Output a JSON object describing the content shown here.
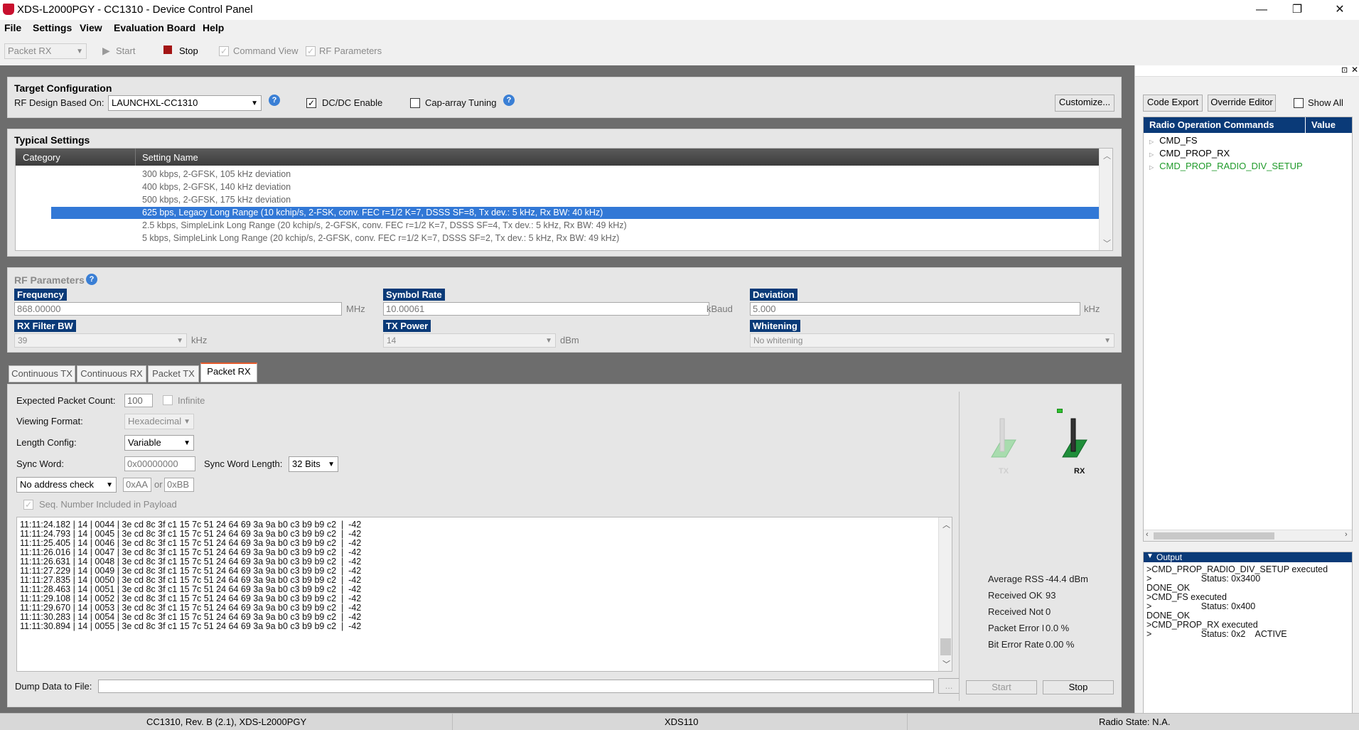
{
  "window": {
    "title": "XDS-L2000PGY - CC1310 - Device Control Panel",
    "minimize": "—",
    "restore": "❐",
    "close": "✕"
  },
  "menu": [
    "File",
    "Settings",
    "View",
    "Evaluation Board",
    "Help"
  ],
  "toolbar": {
    "mode": "Packet RX",
    "start": "Start",
    "stop": "Stop",
    "command_view": "Command View",
    "rf_parameters": "RF Parameters"
  },
  "target_config": {
    "title": "Target Configuration",
    "rf_design_label": "RF Design Based On:",
    "rf_design_value": "LAUNCHXL-CC1310",
    "dcdc": "DC/DC Enable",
    "dcdc_checked": true,
    "cap_array": "Cap-array Tuning",
    "cap_array_checked": false,
    "customize": "Customize..."
  },
  "typical_settings": {
    "title": "Typical Settings",
    "col_category": "Category",
    "col_setting": "Setting Name",
    "rows": [
      "300 kbps, 2-GFSK, 105 kHz deviation",
      "400 kbps, 2-GFSK, 140 kHz deviation",
      "500 kbps, 2-GFSK, 175 kHz deviation",
      "625 bps, Legacy Long Range (10 kchip/s, 2-FSK, conv. FEC r=1/2 K=7, DSSS SF=8, Tx dev.: 5 kHz, Rx BW: 40 kHz)",
      "2.5 kbps, SimpleLink Long Range (20 kchip/s, 2-GFSK, conv. FEC r=1/2 K=7, DSSS SF=4, Tx dev.: 5 kHz, Rx BW: 49 kHz)",
      "5 kbps, SimpleLink Long Range (20 kchip/s, 2-GFSK, conv. FEC r=1/2 K=7, DSSS SF=2, Tx dev.: 5 kHz, Rx BW: 49 kHz)"
    ],
    "selected_index": 3
  },
  "rf_params": {
    "title": "RF Parameters",
    "frequency_label": "Frequency",
    "frequency": "868.00000",
    "frequency_unit": "MHz",
    "symbol_rate_label": "Symbol Rate",
    "symbol_rate": "10.00061",
    "symbol_rate_unit": "kBaud",
    "deviation_label": "Deviation",
    "deviation": "5.000",
    "deviation_unit": "kHz",
    "rx_filter_label": "RX Filter BW",
    "rx_filter": "39",
    "rx_filter_unit": "kHz",
    "tx_power_label": "TX Power",
    "tx_power": "14",
    "tx_power_unit": "dBm",
    "whitening_label": "Whitening",
    "whitening": "No whitening"
  },
  "tabs": [
    "Continuous TX",
    "Continuous RX",
    "Packet TX",
    "Packet RX"
  ],
  "active_tab": 3,
  "packet_rx": {
    "expected_count_label": "Expected Packet Count:",
    "expected_count": "100",
    "infinite": "Infinite",
    "viewing_format_label": "Viewing Format:",
    "viewing_format": "Hexadecimal",
    "length_config_label": "Length Config:",
    "length_config": "Variable",
    "sync_word_label": "Sync Word:",
    "sync_word": "0x00000000",
    "sync_length_label": "Sync Word Length:",
    "sync_length": "32 Bits",
    "address_check": "No address check",
    "addr1": "0xAA",
    "addr_or": "or",
    "addr2": "0xBB",
    "seq_number": "Seq. Number Included in Payload",
    "log": [
      "11:11:24.182 | 14 | 0044 | 3e cd 8c 3f c1 15 7c 51 24 64 69 3a 9a b0 c3 b9 b9 c2  |  -42",
      "11:11:24.793 | 14 | 0045 | 3e cd 8c 3f c1 15 7c 51 24 64 69 3a 9a b0 c3 b9 b9 c2  |  -42",
      "11:11:25.405 | 14 | 0046 | 3e cd 8c 3f c1 15 7c 51 24 64 69 3a 9a b0 c3 b9 b9 c2  |  -42",
      "11:11:26.016 | 14 | 0047 | 3e cd 8c 3f c1 15 7c 51 24 64 69 3a 9a b0 c3 b9 b9 c2  |  -42",
      "11:11:26.631 | 14 | 0048 | 3e cd 8c 3f c1 15 7c 51 24 64 69 3a 9a b0 c3 b9 b9 c2  |  -42",
      "11:11:27.229 | 14 | 0049 | 3e cd 8c 3f c1 15 7c 51 24 64 69 3a 9a b0 c3 b9 b9 c2  |  -42",
      "11:11:27.835 | 14 | 0050 | 3e cd 8c 3f c1 15 7c 51 24 64 69 3a 9a b0 c3 b9 b9 c2  |  -42",
      "11:11:28.463 | 14 | 0051 | 3e cd 8c 3f c1 15 7c 51 24 64 69 3a 9a b0 c3 b9 b9 c2  |  -42",
      "11:11:29.108 | 14 | 0052 | 3e cd 8c 3f c1 15 7c 51 24 64 69 3a 9a b0 c3 b9 b9 c2  |  -42",
      "11:11:29.670 | 14 | 0053 | 3e cd 8c 3f c1 15 7c 51 24 64 69 3a 9a b0 c3 b9 b9 c2  |  -42",
      "11:11:30.283 | 14 | 0054 | 3e cd 8c 3f c1 15 7c 51 24 64 69 3a 9a b0 c3 b9 b9 c2  |  -42",
      "11:11:30.894 | 14 | 0055 | 3e cd 8c 3f c1 15 7c 51 24 64 69 3a 9a b0 c3 b9 b9 c2  |  -42"
    ],
    "dump_label": "Dump Data to File:",
    "browse": "...",
    "tx_label": "TX",
    "rx_label": "RX",
    "avg_rssi_label": "Average RSSI:",
    "avg_rssi": "-44.4 dBm",
    "received_ok_label": "Received OK:",
    "received_ok": "93",
    "received_not_ok_label": "Received Not OK:",
    "received_not_ok": "0",
    "packet_error_label": "Packet Error Rate:",
    "packet_error": "0.0 %",
    "bit_error_label": "Bit Error Rate:",
    "bit_error": "0.00 %",
    "start": "Start",
    "stop": "Stop"
  },
  "right_panel": {
    "code_export": "Code Export",
    "override_editor": "Override Editor",
    "show_all": "Show All",
    "col_commands": "Radio Operation Commands",
    "col_value": "Value",
    "commands": [
      "CMD_FS",
      "CMD_PROP_RX",
      "CMD_PROP_RADIO_DIV_SETUP"
    ],
    "highlight_color": "#1f9a2a",
    "output_title": "Output",
    "output": [
      ">CMD_PROP_RADIO_DIV_SETUP executed",
      ">                    Status: 0x3400",
      "DONE_OK",
      ">CMD_FS executed",
      ">                    Status: 0x400",
      "DONE_OK",
      ">CMD_PROP_RX executed",
      ">                    Status: 0x2    ACTIVE"
    ]
  },
  "statusbar": {
    "device": "CC1310, Rev. B (2.1), XDS-L2000PGY",
    "probe": "XDS110",
    "radio_state": "Radio State: N.A."
  }
}
